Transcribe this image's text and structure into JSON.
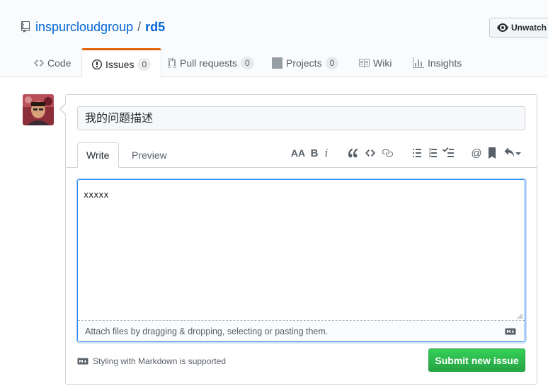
{
  "repo": {
    "owner": "inspurcloudgroup",
    "separator": "/",
    "name": "rd5"
  },
  "watch": {
    "label": "Unwatch"
  },
  "tabs": [
    {
      "label": "Code",
      "icon": "code-icon"
    },
    {
      "label": "Issues",
      "icon": "issue-opened-icon",
      "count": "0",
      "selected": true
    },
    {
      "label": "Pull requests",
      "icon": "git-pull-request-icon",
      "count": "0"
    },
    {
      "label": "Projects",
      "icon": "project-icon",
      "count": "0"
    },
    {
      "label": "Wiki",
      "icon": "book-icon"
    },
    {
      "label": "Insights",
      "icon": "graph-icon"
    }
  ],
  "issue": {
    "title_value": "我的问题描述",
    "body_value": "xxxxx"
  },
  "editor": {
    "write_tab": "Write",
    "preview_tab": "Preview",
    "toolbar": [
      "header-icon",
      "bold-icon",
      "italic-icon",
      "quote-icon",
      "code-icon",
      "link-icon",
      "unordered-list-icon",
      "ordered-list-icon",
      "tasklist-icon",
      "mention-icon",
      "bookmark-icon",
      "reply-icon"
    ],
    "header_glyph": "AA",
    "bold_glyph": "B",
    "italic_glyph": "i",
    "mention_glyph": "@",
    "attach_text": "Attach files by dragging & dropping, selecting or pasting them."
  },
  "footer": {
    "markdown_note": "Styling with Markdown is supported",
    "submit_label": "Submit new issue"
  },
  "colors": {
    "accent": "#0366d6",
    "submit": "#28a745",
    "selected_tab_border": "#e36209"
  }
}
